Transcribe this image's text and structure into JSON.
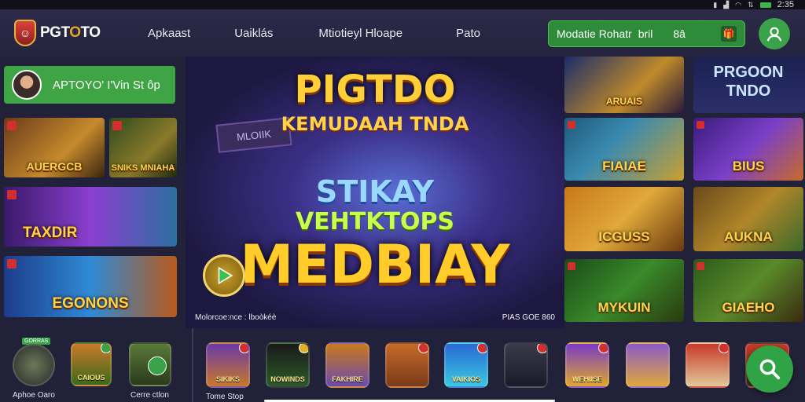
{
  "status_bar": {
    "time": "2:35"
  },
  "header": {
    "brand_prefix": "PGT",
    "brand_o": "O",
    "brand_suffix": "TO",
    "nav": [
      "Apkaast",
      "Uaiklás",
      "Mtiotieyl Hloape",
      "Pato"
    ],
    "promo": {
      "text": "Modatie Rohatr",
      "code": "bril",
      "amount": "8â"
    }
  },
  "left": {
    "banner_text": "APTOYO' I'Vin St ôp",
    "tiles": [
      "AUERGCB",
      "SNIKS MNIAHA",
      "TAXDIR",
      "EGONONS"
    ]
  },
  "hero": {
    "sign": "MLOIIK",
    "title": "PIGTDO",
    "subtitle": "KEMUDAAH TNDA",
    "line3": "STIKAY",
    "line4": "VEHTKTOPS",
    "main": "MEDBIAY",
    "footer_left": "Molorcoe:nce : lboòkéè",
    "footer_right": "PIAS GOE 860"
  },
  "right": {
    "top_left_tile": "ARUAIS",
    "title_line1": "PRGOON",
    "title_line2": "TNDO",
    "tiles": [
      "FIAIAE",
      "BIUS",
      "ICGUSS",
      "AUKNA",
      "MYKUIN",
      "GIAEHO"
    ]
  },
  "bottom_left": [
    {
      "tag": "GORRAS",
      "label": "Aphoe Oaro"
    },
    {
      "label": "",
      "caption": "CAIOUS"
    },
    {
      "label": "Cerre ctlon"
    }
  ],
  "bottom_icons": [
    {
      "caption": "SIKIKS",
      "label": "Tome Stop"
    },
    {
      "caption": "NOWINDS"
    },
    {
      "caption": "FAKHIRE"
    },
    {
      "caption": ""
    },
    {
      "caption": "VAIKIOS"
    },
    {
      "caption": ""
    },
    {
      "caption": "WEHIISE"
    },
    {
      "caption": ""
    },
    {
      "caption": ""
    },
    {
      "caption": ""
    }
  ]
}
